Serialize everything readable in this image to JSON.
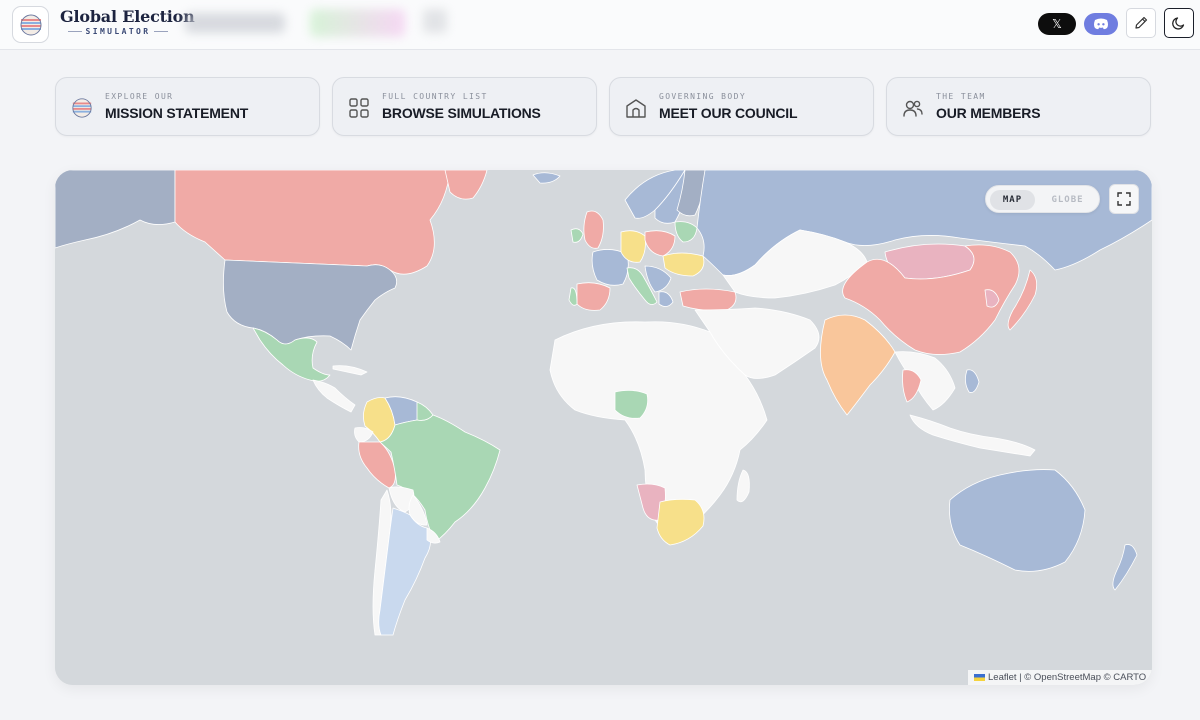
{
  "header": {
    "brand_title": "Global Election",
    "brand_subtitle": "SIMULATOR",
    "social": {
      "x_label": "𝕏"
    }
  },
  "nav_cards": [
    {
      "kicker": "EXPLORE OUR",
      "label": "MISSION STATEMENT",
      "icon": "globe-logo-icon"
    },
    {
      "kicker": "FULL COUNTRY LIST",
      "label": "BROWSE SIMULATIONS",
      "icon": "grid-icon"
    },
    {
      "kicker": "GOVERNING BODY",
      "label": "MEET OUR COUNCIL",
      "icon": "building-icon"
    },
    {
      "kicker": "THE TEAM",
      "label": "OUR MEMBERS",
      "icon": "users-icon"
    }
  ],
  "map": {
    "view_toggle": {
      "options": [
        "MAP",
        "GLOBE"
      ],
      "selected": "MAP"
    },
    "attribution": "Leaflet | © OpenStreetMap © CARTO",
    "colors": {
      "ocean": "#d4d8dc",
      "unassigned": "#f7f7f7",
      "red": "#f0aaa6",
      "blue": "#a7b9d6",
      "slate": "#a3afc4",
      "green": "#a9d7b4",
      "yellow": "#f7e08a",
      "orange": "#f9c69b",
      "light_blue": "#c9d9ee",
      "pink": "#e9b3c0"
    }
  }
}
